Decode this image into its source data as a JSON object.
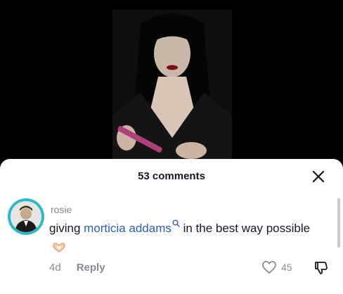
{
  "comments_panel": {
    "title": "53 comments"
  },
  "comment": {
    "username": "rosie",
    "text_before": "giving ",
    "mention": "morticia addams",
    "text_after": " in the best way possible",
    "time": "4d",
    "reply_label": "Reply",
    "like_count": "45"
  },
  "icons": {
    "close": "close-icon",
    "search": "search-icon",
    "heart_hands": "heart-hands-emoji",
    "like": "heart-outline-icon",
    "dislike": "thumbs-down-icon"
  },
  "colors": {
    "mention": "#2b5db9",
    "avatar_ring": "#29b9c9",
    "muted": "#8a8b91"
  }
}
